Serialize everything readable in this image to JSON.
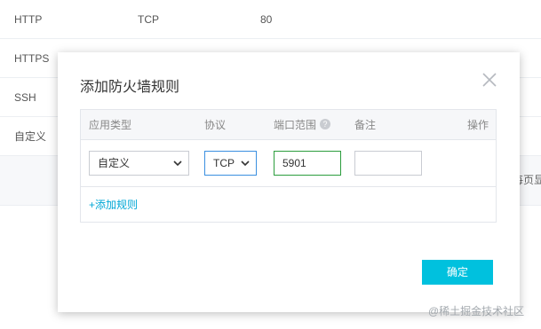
{
  "background_table": {
    "rows": [
      {
        "name": "HTTP",
        "protocol": "TCP",
        "port": "80"
      },
      {
        "name": "HTTPS",
        "protocol": "",
        "port": ""
      },
      {
        "name": "SSH",
        "protocol": "",
        "port": ""
      },
      {
        "name": "自定义",
        "protocol": "",
        "port": ""
      }
    ],
    "footer_partial_text": "每页显"
  },
  "modal": {
    "title": "添加防火墙规则",
    "columns": {
      "type": "应用类型",
      "protocol": "协议",
      "port_range": "端口范围",
      "note": "备注",
      "action": "操作"
    },
    "row": {
      "type_value": "自定义",
      "protocol_value": "TCP",
      "port_value": "5901",
      "note_value": ""
    },
    "add_rule_label": "+添加规则",
    "confirm_label": "确定"
  },
  "colors": {
    "accent": "#00c1de",
    "link": "#00a7d6",
    "focus_blue": "#3a8fe0",
    "focus_green": "#2c9d3d"
  },
  "icons": [
    "close-icon",
    "help-icon",
    "chevron-down-icon"
  ],
  "watermark": "@稀土掘金技术社区"
}
